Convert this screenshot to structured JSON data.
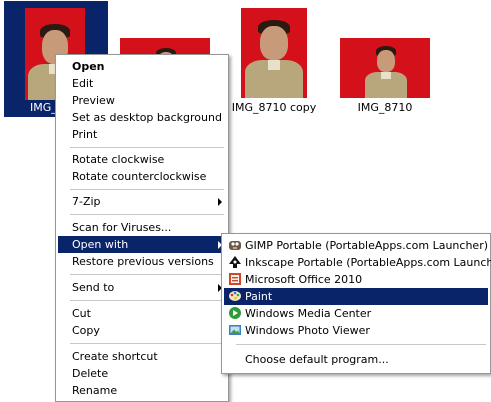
{
  "thumbnails": [
    {
      "label": "IMG_",
      "selected": true
    },
    {
      "label": "",
      "selected": false
    },
    {
      "label": "IMG_8710 copy",
      "selected": false
    },
    {
      "label": "IMG_8710",
      "selected": false
    }
  ],
  "context_menu": {
    "items": [
      {
        "label": "Open",
        "bold": true
      },
      {
        "label": "Edit"
      },
      {
        "label": "Preview"
      },
      {
        "label": "Set as desktop background"
      },
      {
        "label": "Print"
      },
      {
        "label": "Rotate clockwise"
      },
      {
        "label": "Rotate counterclockwise"
      },
      {
        "label": "7-Zip"
      },
      {
        "label": "Scan for Viruses..."
      },
      {
        "label": "Open with"
      },
      {
        "label": "Restore previous versions"
      },
      {
        "label": "Send to"
      },
      {
        "label": "Cut"
      },
      {
        "label": "Copy"
      },
      {
        "label": "Create shortcut"
      },
      {
        "label": "Delete"
      },
      {
        "label": "Rename"
      }
    ]
  },
  "open_with_menu": {
    "items": [
      {
        "label": "GIMP Portable (PortableApps.com Launcher)",
        "icon": "gimp-icon"
      },
      {
        "label": "Inkscape Portable (PortableApps.com Launcher)",
        "icon": "inkscape-icon"
      },
      {
        "label": "Microsoft Office 2010",
        "icon": "office-icon"
      },
      {
        "label": "Paint",
        "icon": "paint-icon",
        "highlighted": true
      },
      {
        "label": "Windows Media Center",
        "icon": "media-center-icon"
      },
      {
        "label": "Windows Photo Viewer",
        "icon": "photo-viewer-icon"
      },
      {
        "label": "Choose default program..."
      }
    ]
  },
  "colors": {
    "selection": "#0a246a",
    "photo_background": "#d4101a"
  }
}
